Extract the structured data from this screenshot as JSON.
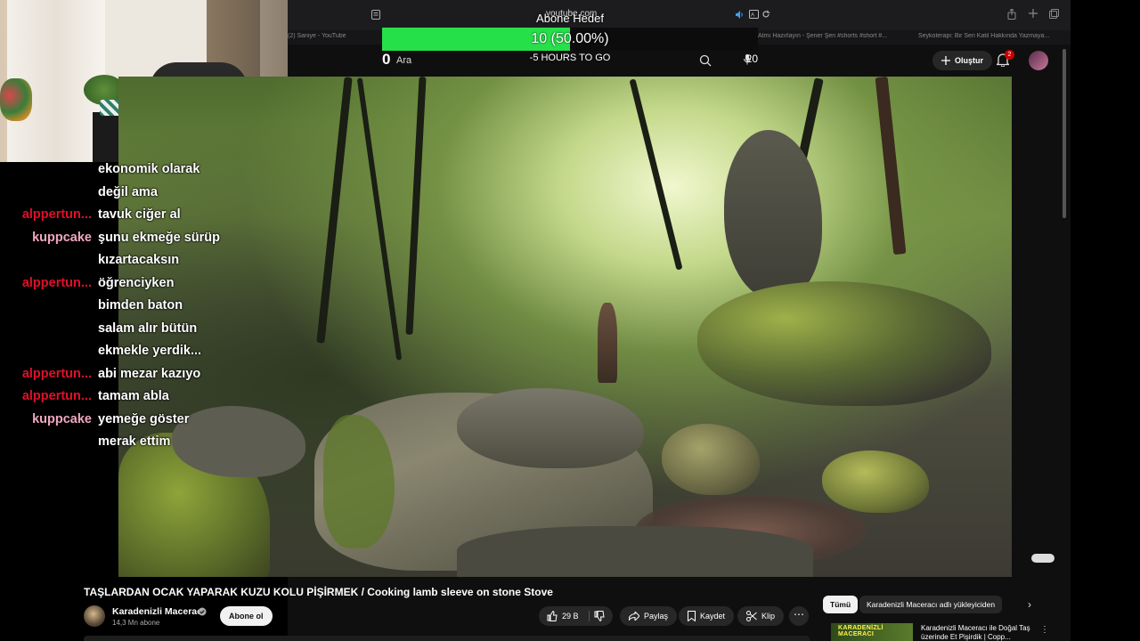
{
  "browser": {
    "url": "youtube.com",
    "tabs": [
      "(2) Saniye - YouTube",
      "Atmı Hazırlayın - Şener Şen #shorts #short #...",
      "Seykoterapi: Bir Seri Katil Hakkında Yazmaya..."
    ]
  },
  "youtube": {
    "create_label": "Oluştur",
    "notification_count": "2",
    "search_icon": "search-icon",
    "mic_icon": "mic-icon"
  },
  "overlay": {
    "goal_title": "Abone Hedef",
    "goal_progress_text": "10 (50.00%)",
    "goal_fraction": 0.5,
    "goal_fill_color": "#26e04a",
    "start_value": "0",
    "break_label": "Ara",
    "countdown": "-5 HOURS TO GO",
    "end_value": "20"
  },
  "chat": {
    "user_colors": {
      "alppertun...": "#e0102a",
      "kuppcake": "#f0a7c0"
    },
    "lines": [
      {
        "user": "",
        "message": "ekonomik olarak"
      },
      {
        "user": "",
        "message": "değil ama"
      },
      {
        "user": "alppertun...",
        "message": "tavuk ciğer al"
      },
      {
        "user": "kuppcake",
        "message": "şunu ekmeğe sürüp"
      },
      {
        "user": "",
        "message": "kızartacaksın"
      },
      {
        "user": "alppertun...",
        "message": "öğrenciyken"
      },
      {
        "user": "",
        "message": "bimden baton"
      },
      {
        "user": "",
        "message": "salam alır bütün"
      },
      {
        "user": "",
        "message": "ekmekle yerdik..."
      },
      {
        "user": "alppertun...",
        "message": "abi mezar kazıyo"
      },
      {
        "user": "alppertun...",
        "message": "tamam abla"
      },
      {
        "user": "kuppcake",
        "message": "yemeğe göster"
      },
      {
        "user": "",
        "message": "merak ettim"
      }
    ]
  },
  "video": {
    "title": "TAŞLARDAN OCAK YAPARAK KUZU KOLU PİŞİRMEK / Cooking lamb sleeve on stone Stove",
    "channel_name": "Karadenizli Maceracı",
    "subscriber_count": "14,3 Mn abone",
    "subscribe_label": "Abone ol",
    "like_count": "29 B",
    "share_label": "Paylaş",
    "save_label": "Kaydet",
    "clip_label": "Klip",
    "more_label": "⋯"
  },
  "recommendations": {
    "chips": [
      "Tümü",
      "Karadenizli Maceracı adlı yükleyiciden"
    ],
    "first_item_title": "Karadenizli Maceracı ile Doğal Taş üzerinde Et Pişirdik | Copp...",
    "first_item_thumb_text": "KARADENİZLİ MACERACI"
  }
}
